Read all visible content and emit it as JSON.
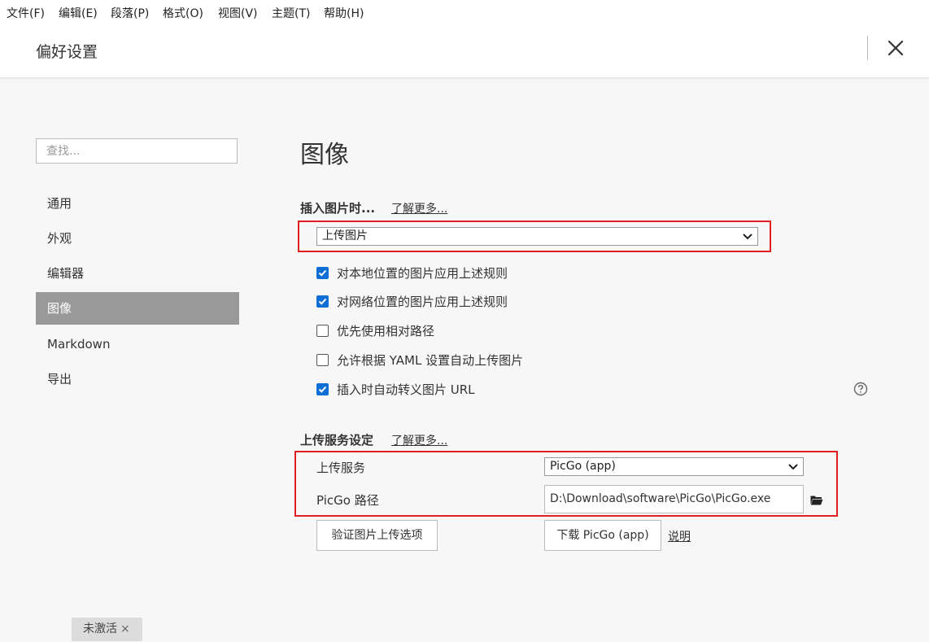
{
  "menubar": {
    "items": [
      "文件(F)",
      "编辑(E)",
      "段落(P)",
      "格式(O)",
      "视图(V)",
      "主题(T)",
      "帮助(H)"
    ]
  },
  "window": {
    "title": "偏好设置",
    "close_icon": "close-icon"
  },
  "sidebar": {
    "search_placeholder": "查找...",
    "items": [
      {
        "label": "通用"
      },
      {
        "label": "外观"
      },
      {
        "label": "编辑器"
      },
      {
        "label": "图像",
        "active": true
      },
      {
        "label": "Markdown"
      },
      {
        "label": "导出"
      }
    ],
    "active_color": "#999999"
  },
  "main": {
    "heading": "图像",
    "insert_section": {
      "label": "插入图片时...",
      "learn_more": "了解更多...",
      "selected_action": "上传图片"
    },
    "options": [
      {
        "label": "对本地位置的图片应用上述规则",
        "checked": true
      },
      {
        "label": "对网络位置的图片应用上述规则",
        "checked": true
      },
      {
        "label": "优先使用相对路径",
        "checked": false
      },
      {
        "label": "允许根据 YAML 设置自动上传图片",
        "checked": false
      },
      {
        "label": "插入时自动转义图片 URL",
        "checked": true
      }
    ],
    "upload_section": {
      "label": "上传服务设定",
      "learn_more": "了解更多...",
      "service_label": "上传服务",
      "service_value": "PicGo (app)",
      "path_label": "PicGo 路径",
      "path_value": "D:\\Download\\software\\PicGo\\PicGo.exe",
      "verify_button": "验证图片上传选项",
      "download_button": "下载 PicGo (app)",
      "explain_link": "说明"
    }
  },
  "status_badge": {
    "label": "未激活",
    "close": "×"
  },
  "colors": {
    "highlight_border": "#e02020",
    "checkbox_checked": "#0d6fd6"
  }
}
